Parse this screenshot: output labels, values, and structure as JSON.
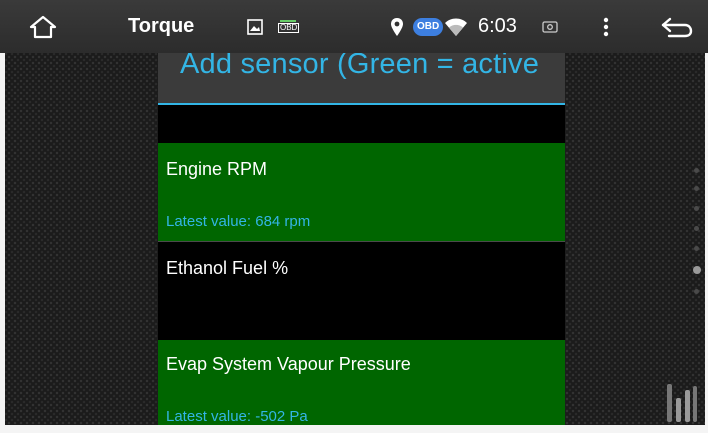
{
  "status_bar": {
    "home_icon": "home-outline-icon",
    "app_title": "Torque",
    "image_icon": "image-icon",
    "obd_small_label": "OBD",
    "location_icon": "location-pin-icon",
    "obd_badge": "OBD",
    "wifi_icon": "wifi-icon",
    "time": "6:03",
    "screenshot_icon": "screenshot-icon",
    "menu_icon": "overflow-menu-icon",
    "back_icon": "back-arrow-icon"
  },
  "dialog": {
    "title": "Add sensor (Green  = active",
    "items": [
      {
        "name": "Engine RPM",
        "latest": "Latest value: 684 rpm",
        "active": true
      },
      {
        "name": "Ethanol Fuel %",
        "latest": "",
        "active": false
      },
      {
        "name": "Evap System Vapour Pressure",
        "latest": "Latest value: -502 Pa",
        "active": true
      }
    ]
  },
  "side_panel": {
    "slider_icon": "equalizer-sliders-icon"
  },
  "colors": {
    "accent": "#33b5e5",
    "active_row": "#006600",
    "status_bar": "#333333",
    "header": "#3b3b3b"
  }
}
